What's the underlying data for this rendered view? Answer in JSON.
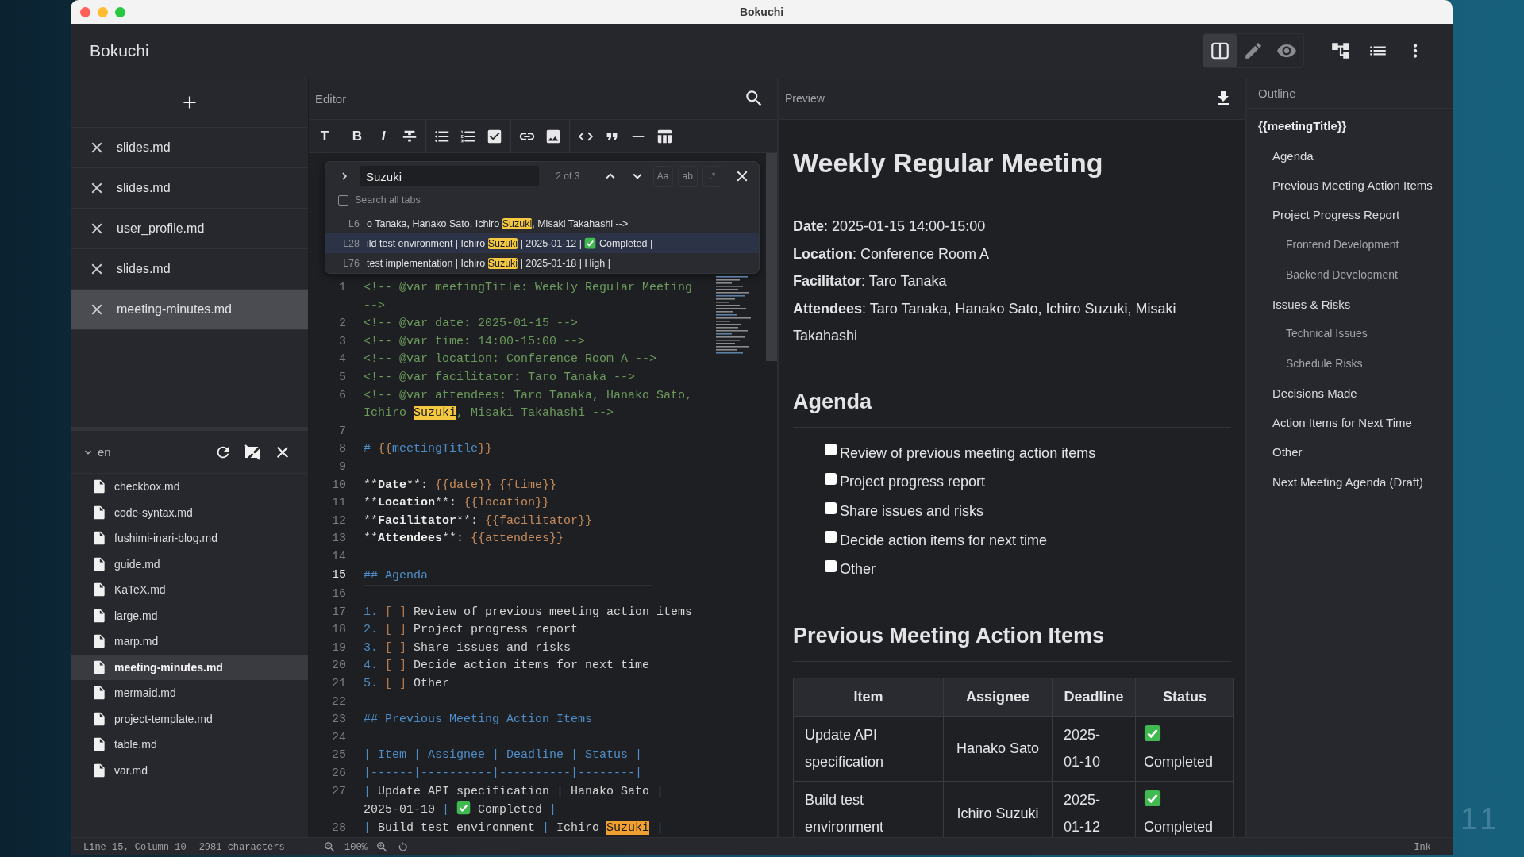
{
  "desktop": {
    "corner_text": "11"
  },
  "window": {
    "title": "Bokuchi"
  },
  "header": {
    "app_name": "Bokuchi",
    "view_modes": [
      {
        "kind": "split",
        "selected": true
      },
      {
        "kind": "edit",
        "selected": false
      },
      {
        "kind": "preview",
        "selected": false
      }
    ],
    "actions": [
      {
        "kind": "tree"
      },
      {
        "kind": "list"
      },
      {
        "kind": "more"
      }
    ]
  },
  "sidebar": {
    "tabs": [
      {
        "label": "slides.md",
        "selected": false
      },
      {
        "label": "slides.md",
        "selected": false
      },
      {
        "label": "user_profile.md",
        "selected": false
      },
      {
        "label": "slides.md",
        "selected": false
      },
      {
        "label": "meeting-minutes.md",
        "selected": true
      }
    ],
    "folder": {
      "name": "en",
      "expanded": true,
      "files": [
        {
          "label": "checkbox.md",
          "selected": false
        },
        {
          "label": "code-syntax.md",
          "selected": false
        },
        {
          "label": "fushimi-inari-blog.md",
          "selected": false
        },
        {
          "label": "guide.md",
          "selected": false
        },
        {
          "label": "KaTeX.md",
          "selected": false
        },
        {
          "label": "large.md",
          "selected": false
        },
        {
          "label": "marp.md",
          "selected": false
        },
        {
          "label": "meeting-minutes.md",
          "selected": true
        },
        {
          "label": "mermaid.md",
          "selected": false
        },
        {
          "label": "project-template.md",
          "selected": false
        },
        {
          "label": "table.md",
          "selected": false
        },
        {
          "label": "var.md",
          "selected": false
        }
      ]
    }
  },
  "editor": {
    "title": "Editor",
    "toolbar": [
      [
        {
          "kind": "heading",
          "text": "T"
        }
      ],
      [
        {
          "kind": "bold",
          "text": "B"
        },
        {
          "kind": "italic",
          "text": "I"
        },
        {
          "kind": "strike"
        }
      ],
      [
        {
          "kind": "bullets"
        },
        {
          "kind": "numbers"
        },
        {
          "kind": "task"
        }
      ],
      [
        {
          "kind": "link"
        },
        {
          "kind": "image"
        }
      ],
      [
        {
          "kind": "code"
        },
        {
          "kind": "quote"
        },
        {
          "kind": "rule"
        },
        {
          "kind": "table"
        }
      ]
    ],
    "find": {
      "query": "Suzuki",
      "count": "2 of 3",
      "options": [
        {
          "label": "Aa",
          "on": false
        },
        {
          "label": "ab",
          "on": false
        },
        {
          "label": ".*",
          "on": false
        }
      ],
      "search_all_tabs": {
        "label": "Search all tabs",
        "checked": false
      },
      "results": [
        {
          "line": "L6",
          "before": "o Tanaka, Hanako Sato, Ichiro ",
          "match": "Suzuki",
          "after": ", Misaki Takahashi -->",
          "done": false,
          "selected": false
        },
        {
          "line": "L28",
          "before": "ild test environment | Ichiro ",
          "match": "Suzuki",
          "after": " | 2025-01-12 | ",
          "done": true,
          "after_done": " Completed |",
          "selected": true
        },
        {
          "line": "L76",
          "before": "test implementation | Ichiro ",
          "match": "Suzuki",
          "after": " | 2025-01-18 | High |",
          "done": false,
          "selected": false
        }
      ]
    },
    "lines": [
      {
        "number": "1",
        "current": false,
        "segments": [
          {
            "kind": "comment",
            "text": "<!-- @var meetingTitle: Weekly Regular Meeting -->"
          }
        ]
      },
      {
        "number": "2",
        "current": false,
        "segments": [
          {
            "kind": "comment",
            "text": "<!-- @var date: 2025-01-15 -->"
          }
        ]
      },
      {
        "number": "3",
        "current": false,
        "segments": [
          {
            "kind": "comment",
            "text": "<!-- @var time: 14:00-15:00 -->"
          }
        ]
      },
      {
        "number": "4",
        "current": false,
        "segments": [
          {
            "kind": "comment",
            "text": "<!-- @var location: Conference Room A -->"
          }
        ]
      },
      {
        "number": "5",
        "current": false,
        "segments": [
          {
            "kind": "comment",
            "text": "<!-- @var facilitator: Taro Tanaka -->"
          }
        ]
      },
      {
        "number": "6",
        "current": false,
        "segments": [
          {
            "kind": "comment",
            "text": "<!-- @var attendees: Taro Tanaka, Hanako Sato, Ichiro "
          },
          {
            "kind": "match",
            "text": "Suzuki"
          },
          {
            "kind": "comment",
            "text": ", Misaki Takahashi -->"
          }
        ]
      },
      {
        "number": "7",
        "current": false
      },
      {
        "number": "8",
        "current": false,
        "segments": [
          {
            "kind": "heading",
            "text": "# "
          },
          {
            "kind": "var",
            "text": "{{"
          },
          {
            "kind": "heading",
            "text": "meetingTitle"
          },
          {
            "kind": "var",
            "text": "}}"
          }
        ]
      },
      {
        "number": "9",
        "current": false
      },
      {
        "number": "10",
        "current": false,
        "segments": [
          {
            "kind": "text",
            "text": "**"
          },
          {
            "kind": "bold",
            "text": "Date"
          },
          {
            "kind": "text",
            "text": "**: "
          },
          {
            "kind": "var",
            "text": "{{date}} {{time}}"
          }
        ]
      },
      {
        "number": "11",
        "current": false,
        "segments": [
          {
            "kind": "text",
            "text": "**"
          },
          {
            "kind": "bold",
            "text": "Location"
          },
          {
            "kind": "text",
            "text": "**: "
          },
          {
            "kind": "var",
            "text": "{{location}}"
          }
        ]
      },
      {
        "number": "12",
        "current": false,
        "segments": [
          {
            "kind": "text",
            "text": "**"
          },
          {
            "kind": "bold",
            "text": "Facilitator"
          },
          {
            "kind": "text",
            "text": "**: "
          },
          {
            "kind": "var",
            "text": "{{facilitator}}"
          }
        ]
      },
      {
        "number": "13",
        "current": false,
        "segments": [
          {
            "kind": "text",
            "text": "**"
          },
          {
            "kind": "bold",
            "text": "Attendees"
          },
          {
            "kind": "text",
            "text": "**: "
          },
          {
            "kind": "var",
            "text": "{{attendees}}"
          }
        ]
      },
      {
        "number": "14",
        "current": false
      },
      {
        "number": "15",
        "current": true,
        "segments": [
          {
            "kind": "heading",
            "text": "## Agenda"
          }
        ]
      },
      {
        "number": "16",
        "current": false
      },
      {
        "number": "17",
        "current": false,
        "segments": [
          {
            "kind": "listnum",
            "text": "1. "
          },
          {
            "kind": "bracket",
            "text": "[ ]"
          },
          {
            "kind": "text",
            "text": " Review of previous meeting action items"
          }
        ]
      },
      {
        "number": "18",
        "current": false,
        "segments": [
          {
            "kind": "listnum",
            "text": "2. "
          },
          {
            "kind": "bracket",
            "text": "[ ]"
          },
          {
            "kind": "text",
            "text": " Project progress report"
          }
        ]
      },
      {
        "number": "19",
        "current": false,
        "segments": [
          {
            "kind": "listnum",
            "text": "3. "
          },
          {
            "kind": "bracket",
            "text": "[ ]"
          },
          {
            "kind": "text",
            "text": " Share issues and risks"
          }
        ]
      },
      {
        "number": "20",
        "current": false,
        "segments": [
          {
            "kind": "listnum",
            "text": "4. "
          },
          {
            "kind": "bracket",
            "text": "[ ]"
          },
          {
            "kind": "text",
            "text": " Decide action items for next time"
          }
        ]
      },
      {
        "number": "21",
        "current": false,
        "segments": [
          {
            "kind": "listnum",
            "text": "5. "
          },
          {
            "kind": "bracket",
            "text": "[ ]"
          },
          {
            "kind": "text",
            "text": " Other"
          }
        ]
      },
      {
        "number": "22",
        "current": false
      },
      {
        "number": "23",
        "current": false,
        "segments": [
          {
            "kind": "heading",
            "text": "## Previous Meeting Action Items"
          }
        ]
      },
      {
        "number": "24",
        "current": false
      },
      {
        "number": "25",
        "current": false,
        "segments": [
          {
            "kind": "table",
            "text": "| Item | Assignee | Deadline | Status |"
          }
        ]
      },
      {
        "number": "26",
        "current": false,
        "segments": [
          {
            "kind": "table",
            "text": "|------|----------|----------|--------|"
          }
        ]
      },
      {
        "number": "27",
        "current": false,
        "segments": [
          {
            "kind": "table",
            "text": "|"
          },
          {
            "kind": "text",
            "text": " Update API specification "
          },
          {
            "kind": "table",
            "text": "|"
          },
          {
            "kind": "text",
            "text": " Hanako Sato "
          },
          {
            "kind": "table",
            "text": "|"
          },
          {
            "kind": "text",
            "text": " 2025-01-10 "
          },
          {
            "kind": "table",
            "text": "| "
          },
          {
            "kind": "check"
          },
          {
            "kind": "text",
            "text": " Completed "
          },
          {
            "kind": "table",
            "text": "|"
          }
        ]
      },
      {
        "number": "28",
        "current": false,
        "segments": [
          {
            "kind": "table",
            "text": "|"
          },
          {
            "kind": "text",
            "text": " Build test environment "
          },
          {
            "kind": "table",
            "text": "|"
          },
          {
            "kind": "text",
            "text": " Ichiro "
          },
          {
            "kind": "match_current",
            "text": "Suzuki"
          },
          {
            "kind": "table",
            "text": " |"
          }
        ]
      }
    ]
  },
  "preview": {
    "title": "Preview",
    "heading": "Weekly Regular Meeting",
    "meta": [
      "**Date**: 2025-01-15 14:00-15:00",
      "**Location**: Conference Room A",
      "**Facilitator**: Taro Tanaka",
      "**Attendees**: Taro Tanaka, Hanako Sato, Ichiro Suzuki, Misaki Takahashi"
    ],
    "sections": [
      {
        "heading": "Agenda",
        "tasks": [
          {
            "label": "Review of previous meeting action items",
            "checked": false
          },
          {
            "label": "Project progress report",
            "checked": false
          },
          {
            "label": "Share issues and risks",
            "checked": false
          },
          {
            "label": "Decide action items for next time",
            "checked": false
          },
          {
            "label": "Other",
            "checked": false
          }
        ]
      },
      {
        "heading": "Previous Meeting Action Items",
        "table": {
          "columns": [
            "Item",
            "Assignee",
            "Deadline",
            "Status"
          ],
          "rows": [
            {
              "cells": [
                "Update API specification",
                "Hanako Sato",
                "2025-01-10",
                "Completed"
              ],
              "done": true
            },
            {
              "cells": [
                "Build test environment",
                "Ichiro Suzuki",
                "2025-01-12",
                "Completed"
              ],
              "done": true
            }
          ]
        }
      }
    ]
  },
  "outline": {
    "title": "Outline",
    "items": [
      {
        "label": "{{meetingTitle}}",
        "children": [
          {
            "label": "Agenda"
          },
          {
            "label": "Previous Meeting Action Items"
          },
          {
            "label": "Project Progress Report",
            "children": [
              {
                "label": "Frontend Development"
              },
              {
                "label": "Backend Development"
              }
            ]
          },
          {
            "label": "Issues & Risks",
            "children": [
              {
                "label": "Technical Issues"
              },
              {
                "label": "Schedule Risks"
              }
            ]
          },
          {
            "label": "Decisions Made"
          },
          {
            "label": "Action Items for Next Time"
          },
          {
            "label": "Other"
          },
          {
            "label": "Next Meeting Agenda (Draft)"
          }
        ]
      }
    ]
  },
  "status_bar": {
    "position": "Line 15, Column 10",
    "characters": "2981 characters",
    "zoom": "100%",
    "mode": "Ink"
  }
}
